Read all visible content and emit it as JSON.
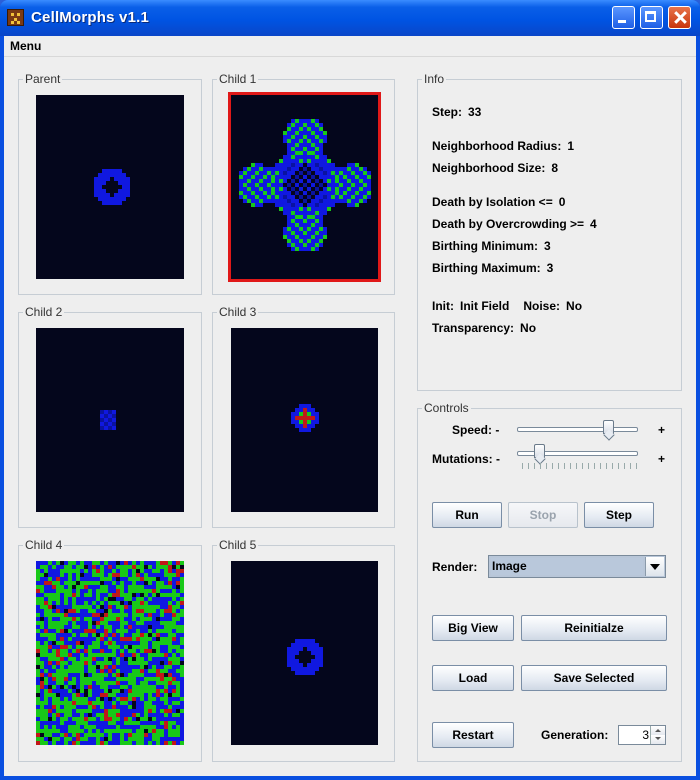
{
  "window": {
    "title": "CellMorphs v1.1",
    "icon": "app-icon"
  },
  "menubar": {
    "menu_label": "Menu"
  },
  "panels": {
    "parent": "Parent",
    "child1": "Child 1",
    "child2": "Child 2",
    "child3": "Child 3",
    "child4": "Child 4",
    "child5": "Child 5"
  },
  "info": {
    "title": "Info",
    "step_label": "Step:",
    "step_value": "33",
    "radius_label": "Neighborhood Radius:",
    "radius_value": "1",
    "size_label": "Neighborhood Size:",
    "size_value": "8",
    "isolation_label": "Death by Isolation <=",
    "isolation_value": "0",
    "overcrowd_label": "Death by Overcrowding >=",
    "overcrowd_value": "4",
    "birth_min_label": "Birthing Minimum:",
    "birth_min_value": "3",
    "birth_max_label": "Birthing Maximum:",
    "birth_max_value": "3",
    "init_label": "Init:",
    "init_value": "Init Field",
    "noise_label": "Noise:",
    "noise_value": "No",
    "transparency_label": "Transparency:",
    "transparency_value": "No"
  },
  "controls": {
    "title": "Controls",
    "speed_label": "Speed: -",
    "speed_plus": "+",
    "speed_level": 0.78,
    "mutations_label": "Mutations: -",
    "mutations_plus": "+",
    "mutations_level": 0.15,
    "run": "Run",
    "stop": "Stop",
    "step": "Step",
    "render_label": "Render:",
    "render_value": "Image",
    "big_view": "Big View",
    "reinit": "Reinitialze",
    "load": "Load",
    "save_selected": "Save Selected",
    "restart": "Restart",
    "generation_label": "Generation:",
    "generation_value": "3"
  },
  "colors": {
    "background": "#04061c",
    "blue": "#1018e0",
    "green": "#18c818",
    "red": "#c01818",
    "selected": "#e01818"
  }
}
